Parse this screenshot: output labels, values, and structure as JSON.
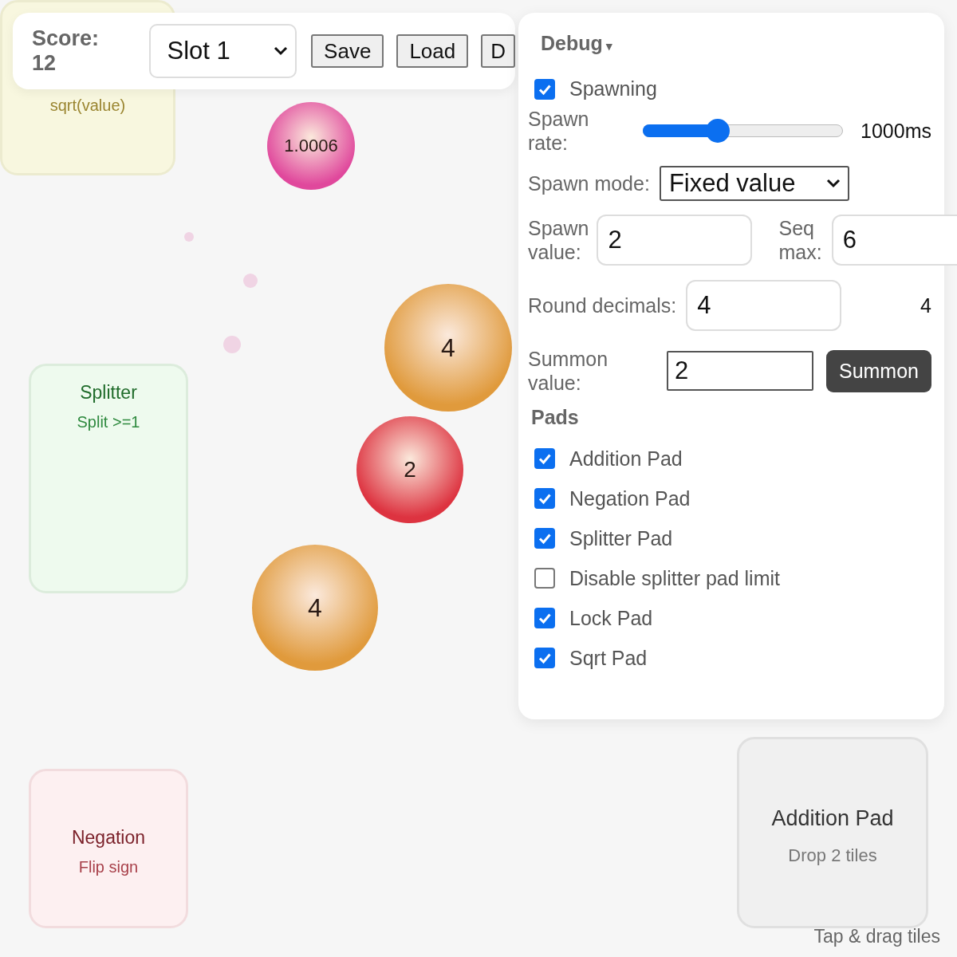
{
  "pads": [
    {
      "kind": "sqrt",
      "subtitle": "sqrt(value)"
    },
    {
      "kind": "splitter",
      "title": "Splitter",
      "subtitle": "Split >=1"
    },
    {
      "kind": "negation",
      "title": "Negation",
      "subtitle": "Flip sign"
    },
    {
      "kind": "addition",
      "title": "Addition Pad",
      "subtitle": "Drop 2 tiles"
    }
  ],
  "balls": [
    {
      "value": "1.0006",
      "color": "#e0489c"
    },
    {
      "value": "4",
      "color": "#e09a3c"
    },
    {
      "value": "2",
      "color": "#dd3340"
    },
    {
      "value": "4",
      "color": "#e09a3c"
    }
  ],
  "hint": "Tap & drag tiles",
  "toolbar": {
    "score": "Score: 12",
    "slot": "Slot 1",
    "buttons": [
      "Save",
      "Load",
      "D"
    ]
  },
  "debug": {
    "title": "Debug",
    "caret": "▾",
    "spawning": {
      "label": "Spawning",
      "checked": true
    },
    "spawn_rate": {
      "label": "Spawn rate:",
      "level": 0.35,
      "reading": "1000ms"
    },
    "spawn_mode": {
      "label": "Spawn mode:",
      "value": "Fixed value"
    },
    "spawn_value": {
      "label": "Spawn value:",
      "value": "2"
    },
    "seq_max": {
      "label": "Seq max:",
      "value": "6"
    },
    "round_decimals": {
      "label": "Round decimals:",
      "value": "4",
      "reading": "4"
    },
    "summon": {
      "label": "Summon value:",
      "value": "2",
      "button": "Summon"
    },
    "pads_heading": "Pads",
    "pads": [
      {
        "label": "Addition Pad",
        "checked": true
      },
      {
        "label": "Negation Pad",
        "checked": true
      },
      {
        "label": "Splitter Pad",
        "checked": true
      },
      {
        "label": "Disable splitter pad limit",
        "checked": false
      },
      {
        "label": "Lock Pad",
        "checked": true
      },
      {
        "label": "Sqrt Pad",
        "checked": true
      }
    ]
  }
}
